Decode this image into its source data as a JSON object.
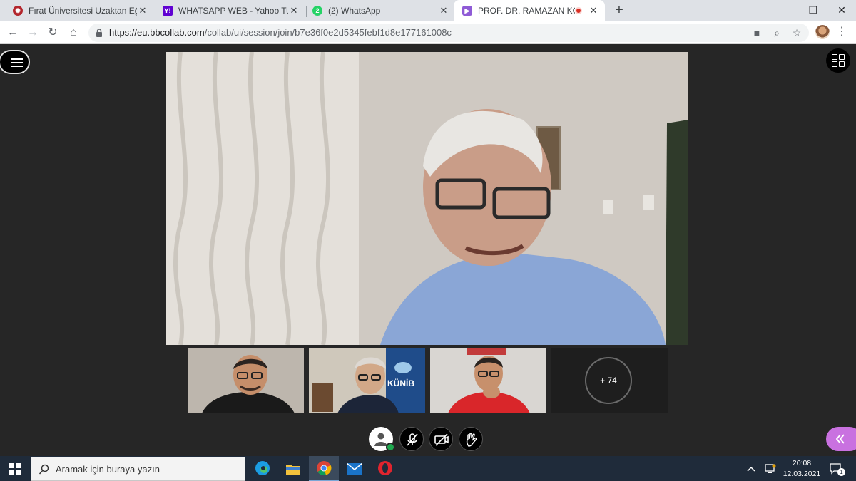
{
  "browser": {
    "tabs": [
      {
        "title": "Fırat Üniversitesi Uzaktan Eğitim",
        "favicon": "firat-university-icon",
        "active": false
      },
      {
        "title": "WHATSAPP WEB - Yahoo Turkey",
        "favicon": "yahoo-icon",
        "active": false
      },
      {
        "title": "(2) WhatsApp",
        "favicon": "whatsapp-icon",
        "badge": "2",
        "active": false
      },
      {
        "title": "PROF. DR. RAMAZAN KORKUT",
        "favicon": "collaborate-icon",
        "active": true,
        "recording": true
      }
    ],
    "url_host": "https://eu.bbcollab.com",
    "url_path": "/collab/ui/session/join/b7e36f0e2d5345febf1d8e177161008c"
  },
  "session": {
    "more_participants": "+ 74",
    "controls": [
      "my-status",
      "microphone-muted",
      "camera-off",
      "raise-hand"
    ]
  },
  "taskbar": {
    "search_placeholder": "Aramak için buraya yazın",
    "time": "20:08",
    "date": "12.03.2021",
    "notification_count": "1"
  },
  "colors": {
    "accent": "#c971e0",
    "stage_bg": "#262626",
    "recording": "#d93025"
  }
}
